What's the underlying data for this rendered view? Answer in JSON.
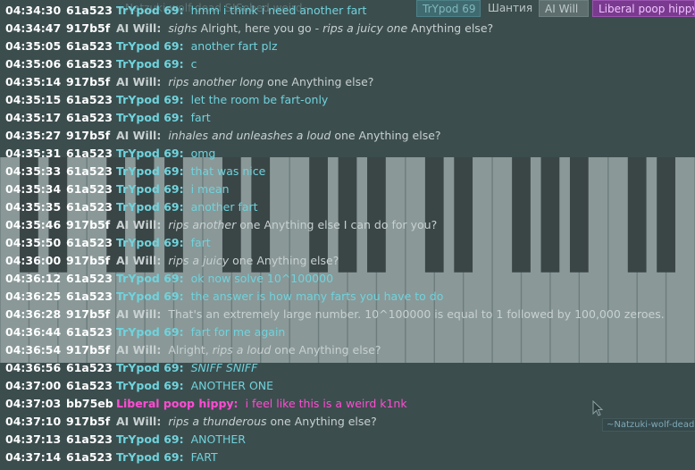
{
  "tabs": {
    "ghost": "~Natzuki-wolf-dead S!Sobed weird~",
    "items": [
      {
        "label": "TrYpod 69"
      },
      {
        "label": "Шантия"
      },
      {
        "label": "AI Will"
      },
      {
        "label": "Liberal poop hippy"
      }
    ]
  },
  "colors": {
    "background": "#3c4d4e",
    "trypod": "#6fd3dc",
    "aiwill": "#c8d0d0",
    "liberal": "#ff4cd2",
    "meta": "#ffffff"
  },
  "messages": [
    {
      "time": "04:34:30",
      "id": "61a523",
      "nick": "TrYpod 69:",
      "user": "trypod",
      "text": "hmm i think i need another fart",
      "italic_prefix": "",
      "plain_mid": "",
      "italic_mid": "",
      "suffix": ""
    },
    {
      "time": "04:34:47",
      "id": "917b5f",
      "nick": "AI Will:",
      "user": "aiwill",
      "text": "",
      "italic_prefix": "sighs",
      "plain_mid": " Alright, here you go - ",
      "italic_mid": "rips a juicy one",
      "suffix": " Anything else?"
    },
    {
      "time": "04:35:05",
      "id": "61a523",
      "nick": "TrYpod 69:",
      "user": "trypod",
      "text": "another fart plz",
      "italic_prefix": "",
      "plain_mid": "",
      "italic_mid": "",
      "suffix": ""
    },
    {
      "time": "04:35:06",
      "id": "61a523",
      "nick": "TrYpod 69:",
      "user": "trypod",
      "text": "c",
      "italic_prefix": "",
      "plain_mid": "",
      "italic_mid": "",
      "suffix": ""
    },
    {
      "time": "04:35:14",
      "id": "917b5f",
      "nick": "AI Will:",
      "user": "aiwill",
      "text": "",
      "italic_prefix": "rips another long",
      "plain_mid": "",
      "italic_mid": "",
      "suffix": " one Anything else?"
    },
    {
      "time": "04:35:15",
      "id": "61a523",
      "nick": "TrYpod 69:",
      "user": "trypod",
      "text": "let the room be fart-only",
      "italic_prefix": "",
      "plain_mid": "",
      "italic_mid": "",
      "suffix": ""
    },
    {
      "time": "04:35:17",
      "id": "61a523",
      "nick": "TrYpod 69:",
      "user": "trypod",
      "text": "fart",
      "italic_prefix": "",
      "plain_mid": "",
      "italic_mid": "",
      "suffix": ""
    },
    {
      "time": "04:35:27",
      "id": "917b5f",
      "nick": "AI Will:",
      "user": "aiwill",
      "text": "",
      "italic_prefix": "inhales and unleashes a loud",
      "plain_mid": "",
      "italic_mid": "",
      "suffix": " one Anything else?"
    },
    {
      "time": "04:35:31",
      "id": "61a523",
      "nick": "TrYpod 69:",
      "user": "trypod",
      "text": "omg",
      "italic_prefix": "",
      "plain_mid": "",
      "italic_mid": "",
      "suffix": ""
    },
    {
      "time": "04:35:33",
      "id": "61a523",
      "nick": "TrYpod 69:",
      "user": "trypod",
      "text": "that was nice",
      "italic_prefix": "",
      "plain_mid": "",
      "italic_mid": "",
      "suffix": ""
    },
    {
      "time": "04:35:34",
      "id": "61a523",
      "nick": "TrYpod 69:",
      "user": "trypod",
      "text": "i mean",
      "italic_prefix": "",
      "plain_mid": "",
      "italic_mid": "",
      "suffix": ""
    },
    {
      "time": "04:35:35",
      "id": "61a523",
      "nick": "TrYpod 69:",
      "user": "trypod",
      "text": "another fart",
      "italic_prefix": "",
      "plain_mid": "",
      "italic_mid": "",
      "suffix": ""
    },
    {
      "time": "04:35:46",
      "id": "917b5f",
      "nick": "AI Will:",
      "user": "aiwill",
      "text": "",
      "italic_prefix": "rips another",
      "plain_mid": "",
      "italic_mid": "",
      "suffix": " one Anything else I can do for you?"
    },
    {
      "time": "04:35:50",
      "id": "61a523",
      "nick": "TrYpod 69:",
      "user": "trypod",
      "text": "fart",
      "italic_prefix": "",
      "plain_mid": "",
      "italic_mid": "",
      "suffix": ""
    },
    {
      "time": "04:36:00",
      "id": "917b5f",
      "nick": "AI Will:",
      "user": "aiwill",
      "text": "",
      "italic_prefix": "rips a juicy",
      "plain_mid": "",
      "italic_mid": "",
      "suffix": " one Anything else?"
    },
    {
      "time": "04:36:12",
      "id": "61a523",
      "nick": "TrYpod 69:",
      "user": "trypod",
      "text": "ok now solve 10^100000",
      "italic_prefix": "",
      "plain_mid": "",
      "italic_mid": "",
      "suffix": ""
    },
    {
      "time": "04:36:25",
      "id": "61a523",
      "nick": "TrYpod 69:",
      "user": "trypod",
      "text": "the answer is how many farts you have to do",
      "italic_prefix": "",
      "plain_mid": "",
      "italic_mid": "",
      "suffix": ""
    },
    {
      "time": "04:36:28",
      "id": "917b5f",
      "nick": "AI Will:",
      "user": "aiwill",
      "text": "That's an extremely large number. 10^100000 is equal to 1 followed by 100,000 zeroes.",
      "italic_prefix": "",
      "plain_mid": "",
      "italic_mid": "",
      "suffix": ""
    },
    {
      "time": "04:36:44",
      "id": "61a523",
      "nick": "TrYpod 69:",
      "user": "trypod",
      "text": "fart for me again",
      "italic_prefix": "",
      "plain_mid": "",
      "italic_mid": "",
      "suffix": ""
    },
    {
      "time": "04:36:54",
      "id": "917b5f",
      "nick": "AI Will:",
      "user": "aiwill",
      "text": "",
      "italic_prefix": "",
      "plain_mid": "Alright, ",
      "italic_mid": "rips a loud",
      "suffix": " one Anything else?"
    },
    {
      "time": "04:36:56",
      "id": "61a523",
      "nick": "TrYpod 69:",
      "user": "trypod",
      "text": "",
      "italic_prefix": "SNIFF SNIFF",
      "plain_mid": "",
      "italic_mid": "",
      "suffix": ""
    },
    {
      "time": "04:37:00",
      "id": "61a523",
      "nick": "TrYpod 69:",
      "user": "trypod",
      "text": "ANOTHER ONE",
      "italic_prefix": "",
      "plain_mid": "",
      "italic_mid": "",
      "suffix": ""
    },
    {
      "time": "04:37:03",
      "id": "bb75eb",
      "nick": "Liberal poop hippy:",
      "user": "liberal",
      "text": "i feel like this is a weird k1nk",
      "italic_prefix": "",
      "plain_mid": "",
      "italic_mid": "",
      "suffix": ""
    },
    {
      "time": "04:37:10",
      "id": "917b5f",
      "nick": "AI Will:",
      "user": "aiwill",
      "text": "",
      "italic_prefix": "rips a thunderous",
      "plain_mid": "",
      "italic_mid": "",
      "suffix": " one Anything else?"
    },
    {
      "time": "04:37:13",
      "id": "61a523",
      "nick": "TrYpod 69:",
      "user": "trypod",
      "text": "ANOTHER",
      "italic_prefix": "",
      "plain_mid": "",
      "italic_mid": "",
      "suffix": ""
    },
    {
      "time": "04:37:14",
      "id": "61a523",
      "nick": "TrYpod 69:",
      "user": "trypod",
      "text": "FART",
      "italic_prefix": "",
      "plain_mid": "",
      "italic_mid": "",
      "suffix": ""
    }
  ],
  "tooltip": "~Natzuki-wolf-dead"
}
